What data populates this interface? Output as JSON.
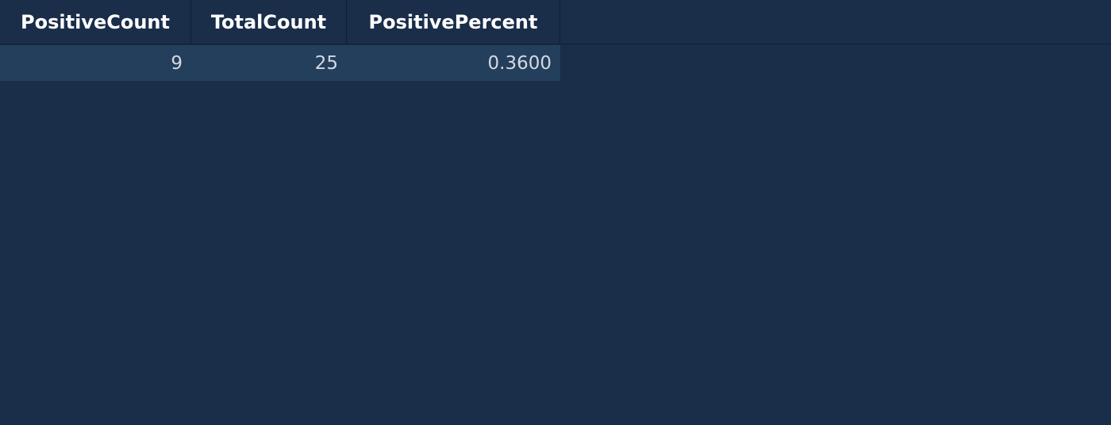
{
  "grid": {
    "columns": [
      "PositiveCount",
      "TotalCount",
      "PositivePercent"
    ],
    "rows": [
      [
        "9",
        "25",
        "0.3600"
      ]
    ]
  },
  "colors": {
    "background": "#1a2d49",
    "row_background": "#243f5c",
    "header_text": "#ffffff",
    "cell_text": "#d2d9e2",
    "grid_line": "#0f1f36"
  }
}
